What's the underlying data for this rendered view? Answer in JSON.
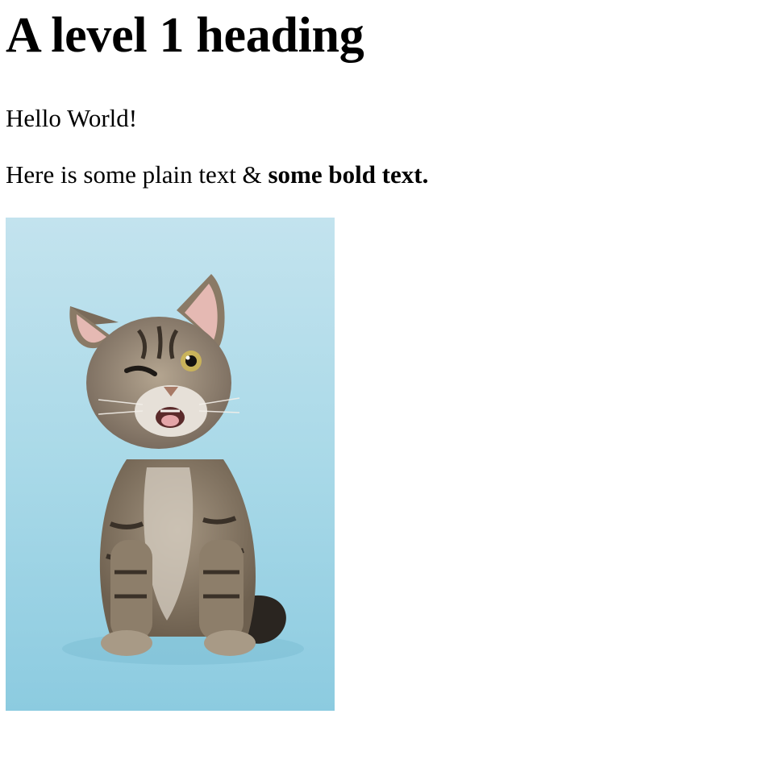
{
  "heading": "A level 1 heading",
  "paragraph_1": "Hello World!",
  "paragraph_2": {
    "plain": "Here is some plain text & ",
    "bold": "some bold text."
  },
  "image": {
    "subject": "winking tabby kitten on light blue background",
    "background_color": "#a9d9e8",
    "fur_color": "#8a7a66"
  }
}
